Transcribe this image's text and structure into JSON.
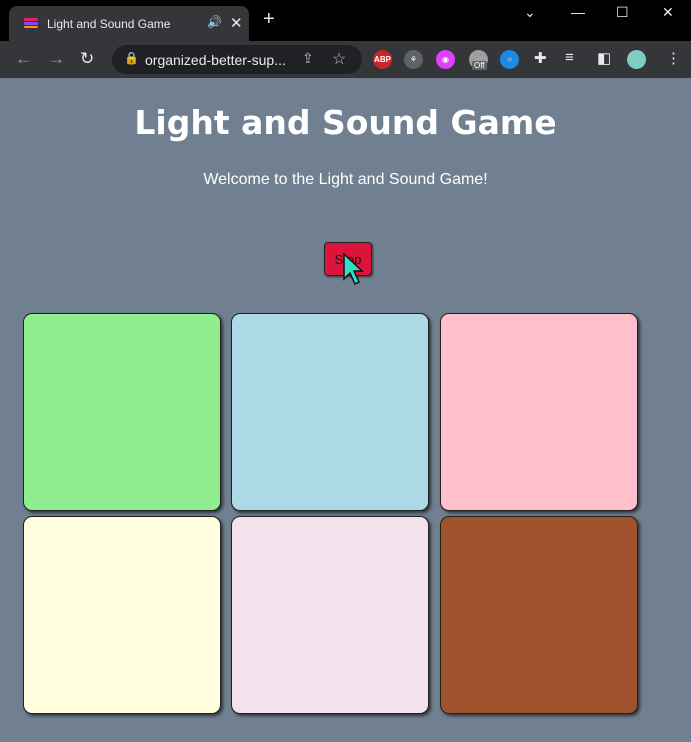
{
  "browser": {
    "tab_title": "Light and Sound Game",
    "url": "organized-better-sup...",
    "ext_abp": "ABP",
    "ext_badge": "Off"
  },
  "page": {
    "title": "Light and Sound Game",
    "welcome": "Welcome to the Light and Sound Game!",
    "stop_label": "Stop"
  },
  "buttons": [
    {
      "color": "#90ee90"
    },
    {
      "color": "#add8e6"
    },
    {
      "color": "#ffc0cb"
    },
    {
      "color": "#ffffe0"
    },
    {
      "color": "#f3e1ec"
    },
    {
      "color": "#a0522d"
    }
  ]
}
